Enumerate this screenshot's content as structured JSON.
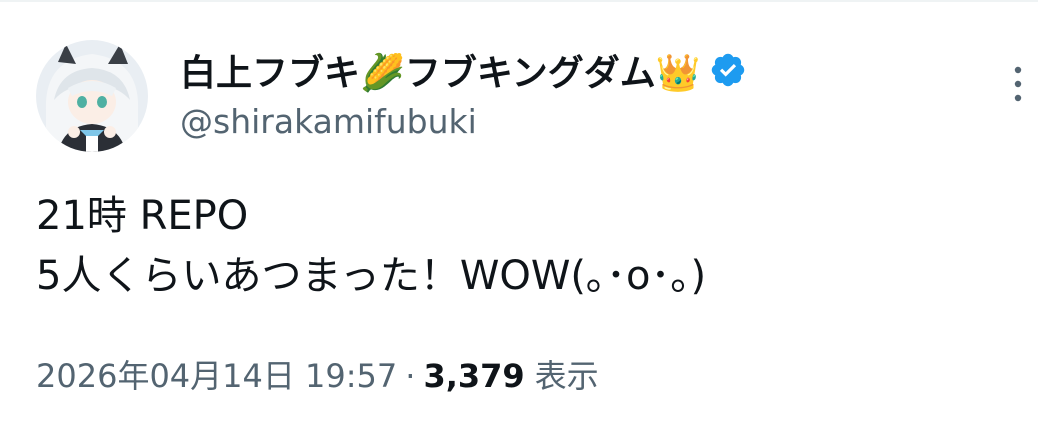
{
  "post": {
    "author": {
      "display_name": "白上フブキ🌽フブキングダム👑",
      "handle": "@shirakamifubuki",
      "verified": true
    },
    "body_lines": [
      "21時  REPO",
      "5人くらいあつまった！WOW(｡･o･｡)"
    ],
    "timestamp": "2026年04月14日 19:57",
    "separator": "·",
    "views_count": "3,379",
    "views_label": "表示"
  },
  "colors": {
    "text_primary": "#0f1419",
    "text_secondary": "#536471",
    "verified_badge": "#1d9bf0",
    "divider": "#eff3f4"
  },
  "icons": {
    "verified": "verified-badge-icon",
    "more": "more-vertical-icon"
  }
}
